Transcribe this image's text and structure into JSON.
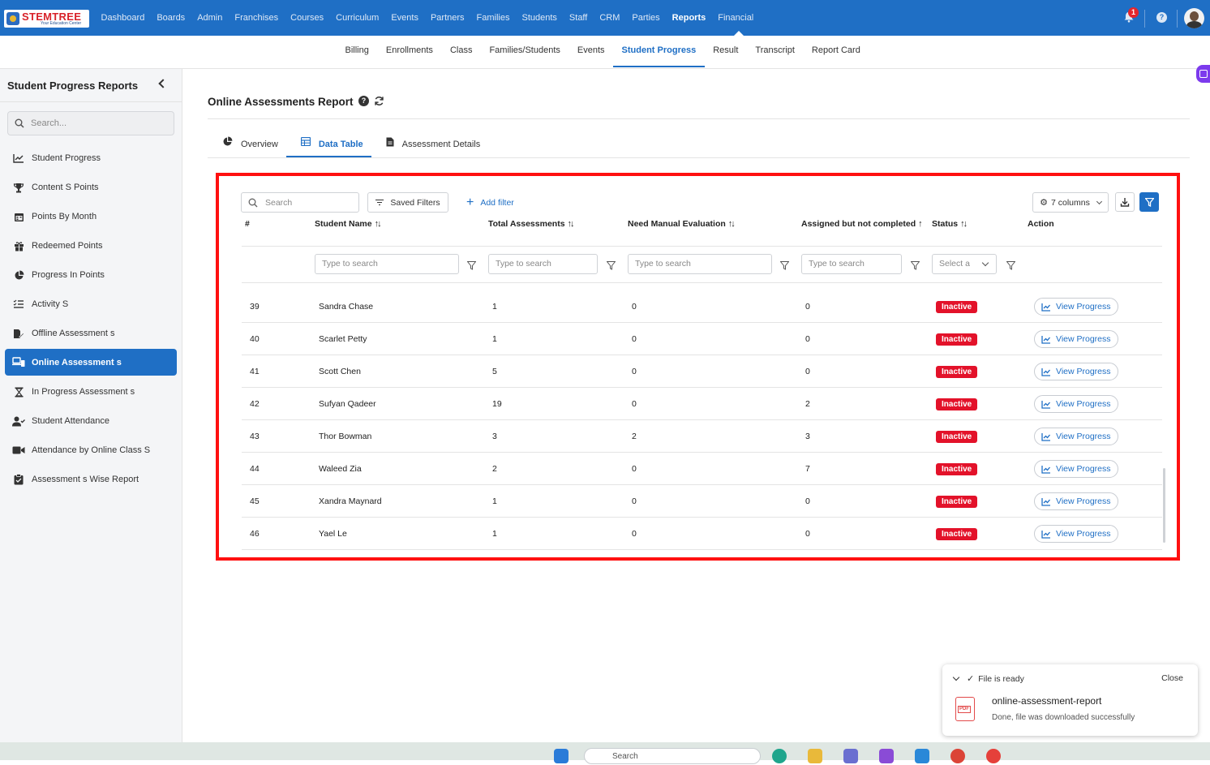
{
  "app": {
    "brand": {
      "name": "STEMTREE",
      "tagline": "Your Education Center"
    },
    "top_menu": [
      "Dashboard",
      "Boards",
      "Admin",
      "Franchises",
      "Courses",
      "Curriculum",
      "Events",
      "Partners",
      "Families",
      "Students",
      "Staff",
      "CRM",
      "Parties",
      "Reports",
      "Financial"
    ],
    "active_top_menu": "Reports",
    "notification_count": "1",
    "help_glyph": "?"
  },
  "subnav": {
    "tabs": [
      "Billing",
      "Enrollments",
      "Class",
      "Families/Students",
      "Events",
      "Student Progress",
      "Result",
      "Transcript",
      "Report Card"
    ],
    "active": "Student Progress"
  },
  "sidebar": {
    "title": "Student Progress Reports",
    "search_placeholder": "Search...",
    "items": [
      {
        "label": "Student Progress",
        "icon": "line-chart-icon"
      },
      {
        "label": "Content S Points",
        "icon": "trophy-icon"
      },
      {
        "label": "Points By Month",
        "icon": "calendar-icon"
      },
      {
        "label": "Redeemed Points",
        "icon": "gift-icon"
      },
      {
        "label": "Progress In Points",
        "icon": "pie-chart-icon"
      },
      {
        "label": "Activity S",
        "icon": "list-check-icon"
      },
      {
        "label": "Offline Assessment s",
        "icon": "file-edit-icon"
      },
      {
        "label": "Online Assessment s",
        "icon": "laptop-icon",
        "active": true
      },
      {
        "label": "In Progress Assessment s",
        "icon": "hourglass-icon"
      },
      {
        "label": "Student Attendance",
        "icon": "user-check-icon"
      },
      {
        "label": "Attendance by Online Class S",
        "icon": "video-icon"
      },
      {
        "label": "Assessment s Wise Report",
        "icon": "clipboard-icon"
      }
    ]
  },
  "main": {
    "title": "Online Assessments Report",
    "view_tabs": [
      {
        "label": "Overview",
        "icon": "pie-chart-icon"
      },
      {
        "label": "Data Table",
        "icon": "table-icon",
        "active": true
      },
      {
        "label": "Assessment Details",
        "icon": "document-icon"
      }
    ]
  },
  "table": {
    "search_placeholder": "Search",
    "saved_filters_label": "Saved Filters",
    "add_filter_label": "Add filter",
    "columns_label": "7 columns",
    "columns": [
      "#",
      "Student Name",
      "Total Assessments",
      "Need Manual Evaluation",
      "Assigned but not completed",
      "Status",
      "Action"
    ],
    "filter_placeholder": "Type to search",
    "status_select_placeholder": "Select a",
    "rows": [
      {
        "num": "39",
        "name": "Sandra Chase",
        "total": "1",
        "manual": "0",
        "assigned": "0",
        "status": "Inactive",
        "action": "View Progress"
      },
      {
        "num": "40",
        "name": "Scarlet Petty",
        "total": "1",
        "manual": "0",
        "assigned": "0",
        "status": "Inactive",
        "action": "View Progress"
      },
      {
        "num": "41",
        "name": "Scott Chen",
        "total": "5",
        "manual": "0",
        "assigned": "0",
        "status": "Inactive",
        "action": "View Progress"
      },
      {
        "num": "42",
        "name": "Sufyan Qadeer",
        "total": "19",
        "manual": "0",
        "assigned": "2",
        "status": "Inactive",
        "action": "View Progress"
      },
      {
        "num": "43",
        "name": "Thor Bowman",
        "total": "3",
        "manual": "2",
        "assigned": "3",
        "status": "Inactive",
        "action": "View Progress"
      },
      {
        "num": "44",
        "name": "Waleed Zia",
        "total": "2",
        "manual": "0",
        "assigned": "7",
        "status": "Inactive",
        "action": "View Progress"
      },
      {
        "num": "45",
        "name": "Xandra Maynard",
        "total": "1",
        "manual": "0",
        "assigned": "0",
        "status": "Inactive",
        "action": "View Progress"
      },
      {
        "num": "46",
        "name": "Yael Le",
        "total": "1",
        "manual": "0",
        "assigned": "0",
        "status": "Inactive",
        "action": "View Progress"
      }
    ]
  },
  "toast": {
    "status": "File is ready",
    "close_label": "Close",
    "file_name": "online-assessment-report",
    "message": "Done, file was downloaded successfully",
    "file_badge": "PDF"
  },
  "taskbar": {
    "search_placeholder": "Search"
  },
  "colors": {
    "primary": "#1f6fc5",
    "danger": "#e3122a",
    "highlight_border": "#ff1010",
    "sidebar_bg": "#f4f5f7"
  }
}
